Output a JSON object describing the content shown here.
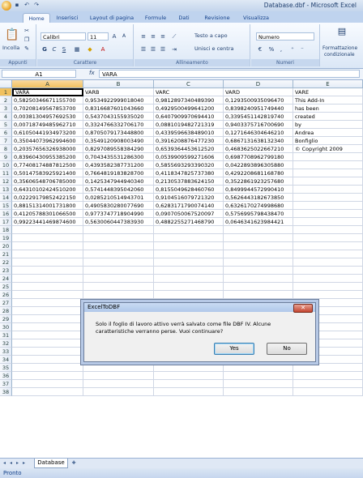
{
  "window": {
    "title": "Database.dbf - Microsoft Excel"
  },
  "ribbon": {
    "tabs": [
      "Home",
      "Inserisci",
      "Layout di pagina",
      "Formule",
      "Dati",
      "Revisione",
      "Visualizza"
    ],
    "clipboard": {
      "paste": "Incolla",
      "group": "Appunti"
    },
    "font": {
      "name": "Calibri",
      "size": "11",
      "bold": "G",
      "italic": "C",
      "underline": "S",
      "group": "Carattere"
    },
    "alignment": {
      "wrap": "Testo a capo",
      "merge": "Unisci e centra",
      "group": "Allineamento"
    },
    "number": {
      "format": "Numero",
      "group": "Numeri"
    },
    "styles": {
      "cond_line1": "Formattazione",
      "cond_line2": "condizionale"
    }
  },
  "formula_bar": {
    "name_box": "A1",
    "fx": "fx",
    "value": "VARA"
  },
  "sheet": {
    "columns": [
      "A",
      "B",
      "C",
      "D",
      "E"
    ],
    "rows": [
      [
        "VARA",
        "VARB",
        "VARC",
        "VARD",
        "VARE"
      ],
      [
        "0,58250346671155700",
        "0,9534922999018040",
        "0,9812897340489390",
        "0,1293500935096470",
        "This Add-In"
      ],
      [
        "0,70208149567853700",
        "0,8316687601043660",
        "0,4929500499641200",
        "0,8398240951749440",
        "has been"
      ],
      [
        "0,00381304957692530",
        "0,5437043155935020",
        "0,6407909970694410",
        "0,3395451142819740",
        "created"
      ],
      [
        "0,00718749485962710",
        "0,3324766332706170",
        "0,0881019482721319",
        "0,9403375716700690",
        "by"
      ],
      [
        "0,61050441934973200",
        "0,8705079173448800",
        "0,4339596638489010",
        "0,1271646304646210",
        "Andrea"
      ],
      [
        "0,35044073962994600",
        "0,3549120908003490",
        "0,3916208876477230",
        "0,6867131638132340",
        "Bonfiglio"
      ],
      [
        "0,20357656326938000",
        "0,8297089558384290",
        "0,6539364453612520",
        "0,4683625022667210",
        "© Copyright 2009"
      ],
      [
        "0,83960430955385200",
        "0,7043435531286300",
        "0,0539909599271606",
        "0,6987708962799180",
        ""
      ],
      [
        "0,77408174887812500",
        "0,4393582387731200",
        "0,5855693293390320",
        "0,0422893896305880",
        ""
      ],
      [
        "0,50147583925921400",
        "0,7664819183828700",
        "0,4118347825737380",
        "0,4292208681168780",
        ""
      ],
      [
        "0,35606548706785000",
        "0,1425347944940340",
        "0,2130537883624150",
        "0,3522861923257680",
        ""
      ],
      [
        "0,64310102424510200",
        "0,5741448395042060",
        "0,8155049628460760",
        "0,8499944572990410",
        ""
      ],
      [
        "0,02229179852422150",
        "0,0285210514943701",
        "0,9104516079721320",
        "0,5626443182673850",
        ""
      ],
      [
        "0,88151314001731800",
        "0,4905830280077690",
        "0,6283171790074140",
        "0,6326170274998680",
        ""
      ],
      [
        "0,41205788301066500",
        "0,9773747718904990",
        "0,0907050067520097",
        "0,5756995798438470",
        ""
      ],
      [
        "0,99223441469874600",
        "0,5630060447383930",
        "0,4882255271468790",
        "0,0646341623984421",
        ""
      ]
    ],
    "total_rows": 38,
    "sheet_tab": "Database"
  },
  "status": "Pronto",
  "dialog": {
    "title": "ExcelToDBF",
    "close": "✕",
    "message": "Solo il foglio di lavoro attivo verrà salvato come file DBF IV. Alcune caratteristiche verranno perse. Vuoi continuare?",
    "yes": "Yes",
    "no": "No"
  }
}
